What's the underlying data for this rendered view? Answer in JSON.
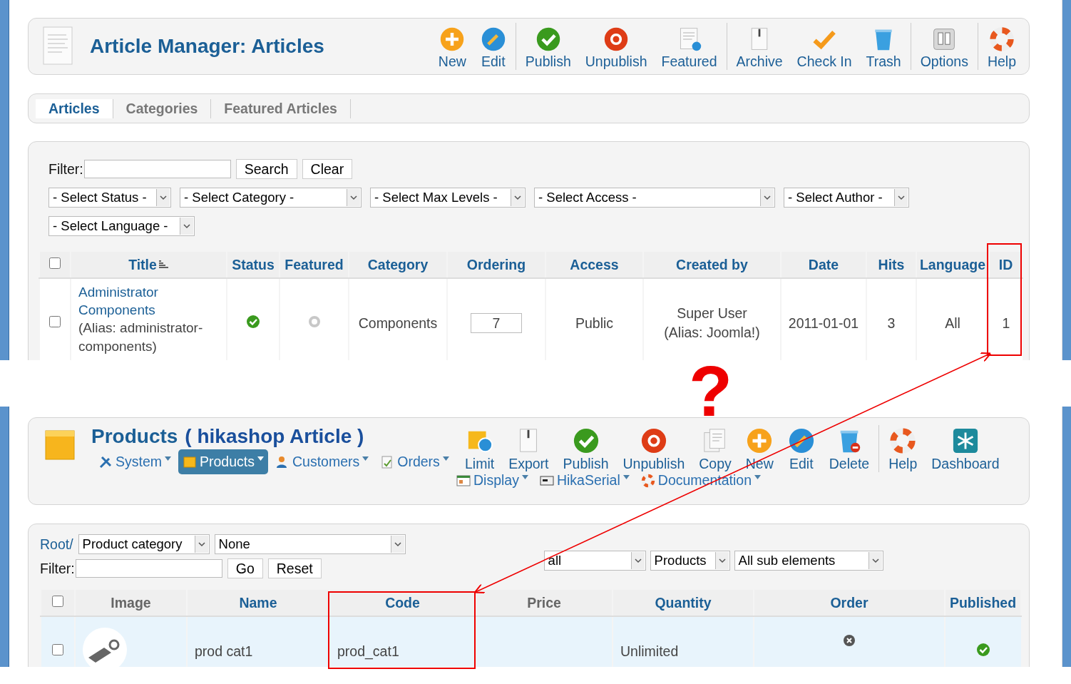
{
  "article_manager": {
    "title": "Article Manager: Articles",
    "toolbar": [
      {
        "label": "New",
        "group_end": false
      },
      {
        "label": "Edit",
        "group_end": true
      },
      {
        "label": "Publish",
        "group_end": false
      },
      {
        "label": "Unpublish",
        "group_end": false
      },
      {
        "label": "Featured",
        "group_end": true
      },
      {
        "label": "Archive",
        "group_end": false
      },
      {
        "label": "Check In",
        "group_end": false
      },
      {
        "label": "Trash",
        "group_end": true
      },
      {
        "label": "Options",
        "group_end": true
      },
      {
        "label": "Help",
        "group_end": false
      }
    ],
    "tabs": [
      {
        "label": "Articles",
        "selected": true
      },
      {
        "label": "Categories",
        "selected": false
      },
      {
        "label": "Featured Articles",
        "selected": false
      }
    ],
    "filter": {
      "label": "Filter:",
      "buttons": [
        "Search",
        "Clear"
      ]
    },
    "selects": [
      "- Select Status -",
      "- Select Category -",
      "- Select Max Levels -",
      "- Select Access -",
      "- Select Author -",
      "- Select Language -"
    ],
    "select_all": false,
    "columns": [
      "Title",
      "Status",
      "Featured",
      "Category",
      "Ordering",
      "Access",
      "Created by",
      "Date",
      "Hits",
      "Language",
      "ID"
    ],
    "rows": [
      {
        "checked": false,
        "title": "Administrator Components",
        "alias": "(Alias: administrator-components)",
        "published": true,
        "featured": false,
        "category": "Components",
        "ordering": "7",
        "access": "Public",
        "created_by": "Super User",
        "created_alias": "(Alias: Joomla!)",
        "date": "2011-01-01",
        "hits": "3",
        "language": "All",
        "id": "1"
      }
    ]
  },
  "products": {
    "title": "Products",
    "subtitle": "( hikashop Article )",
    "menu": [
      {
        "label": "System",
        "selected": false
      },
      {
        "label": "Products",
        "selected": true
      },
      {
        "label": "Customers",
        "selected": false
      },
      {
        "label": "Orders",
        "selected": false
      }
    ],
    "toolbar": [
      {
        "label": "Limit",
        "group_end": false
      },
      {
        "label": "Export",
        "group_end": false
      },
      {
        "label": "Publish",
        "group_end": false
      },
      {
        "label": "Unpublish",
        "group_end": false
      },
      {
        "label": "Copy",
        "group_end": false
      },
      {
        "label": "New",
        "group_end": false
      },
      {
        "label": "Edit",
        "group_end": false
      },
      {
        "label": "Delete",
        "group_end": true
      },
      {
        "label": "Help",
        "group_end": false
      },
      {
        "label": "Dashboard",
        "group_end": false
      }
    ],
    "menu_more": [
      {
        "label": "Display",
        "selected": false
      },
      {
        "label": "HikaSerial",
        "selected": false
      },
      {
        "label": "Documentation",
        "selected": false
      }
    ],
    "root_link": "Root/",
    "category_selects": [
      "Product category",
      "None"
    ],
    "filter": {
      "label": "Filter:",
      "buttons": [
        "Go",
        "Reset"
      ]
    },
    "right_selects": [
      "all",
      "Products",
      "All sub elements"
    ],
    "select_all": false,
    "columns": [
      "Image",
      "Name",
      "Code",
      "Price",
      "Quantity",
      "Order",
      "Published"
    ],
    "rows": [
      {
        "checked": false,
        "name": "prod cat1",
        "code": "prod_cat1",
        "quantity": "Unlimited",
        "published": true
      }
    ]
  },
  "annotation": {
    "mark": "?"
  }
}
